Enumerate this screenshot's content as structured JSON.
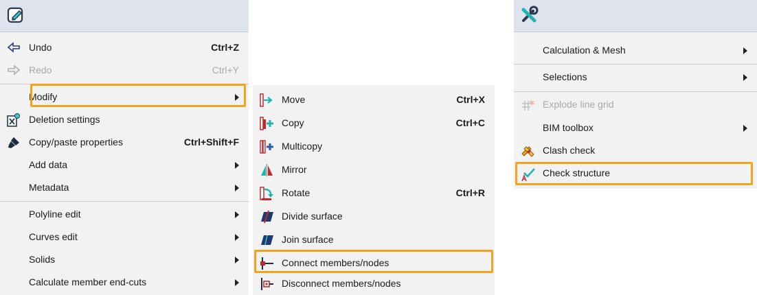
{
  "edit_menu": {
    "title_icon": "edit-pencil-icon",
    "items": [
      {
        "label": "Undo",
        "shortcut": "Ctrl+Z",
        "icon": "undo-arrow-icon"
      },
      {
        "label": "Redo",
        "shortcut": "Ctrl+Y",
        "icon": "redo-arrow-icon",
        "disabled": true
      },
      {
        "label": "Modify",
        "icon": "",
        "submenu": true
      },
      {
        "label": "Deletion settings",
        "icon": "deletion-settings-icon"
      },
      {
        "label": "Copy/paste properties",
        "shortcut": "Ctrl+Shift+F",
        "icon": "paint-brush-icon"
      },
      {
        "label": "Add data",
        "submenu": true
      },
      {
        "label": "Metadata",
        "submenu": true
      },
      {
        "label": "Polyline edit",
        "submenu": true
      },
      {
        "label": "Curves edit",
        "submenu": true
      },
      {
        "label": "Solids",
        "submenu": true
      },
      {
        "label": "Calculate member end-cuts",
        "submenu": true
      }
    ]
  },
  "modify_submenu": {
    "items": [
      {
        "label": "Move",
        "shortcut": "Ctrl+X",
        "icon": "move-icon"
      },
      {
        "label": "Copy",
        "shortcut": "Ctrl+C",
        "icon": "copy-icon"
      },
      {
        "label": "Multicopy",
        "icon": "multicopy-icon"
      },
      {
        "label": "Mirror",
        "icon": "mirror-icon"
      },
      {
        "label": "Rotate",
        "shortcut": "Ctrl+R",
        "icon": "rotate-icon"
      },
      {
        "label": "Divide surface",
        "icon": "divide-surface-icon"
      },
      {
        "label": "Join surface",
        "icon": "join-surface-icon"
      },
      {
        "label": "Connect members/nodes",
        "icon": "connect-nodes-icon"
      },
      {
        "label": "Disconnect members/nodes",
        "icon": "disconnect-nodes-icon"
      }
    ]
  },
  "tools_menu": {
    "title_icon": "tools-wrench-icon",
    "items": [
      {
        "label": "Calculation & Mesh",
        "submenu": true
      },
      {
        "label": "Selections",
        "submenu": true
      },
      {
        "label": "Explode line grid",
        "icon": "explode-grid-icon",
        "disabled": true
      },
      {
        "label": "BIM toolbox",
        "submenu": true
      },
      {
        "label": "Clash check",
        "icon": "clash-check-icon"
      },
      {
        "label": "Check structure",
        "icon": "check-structure-icon"
      }
    ]
  },
  "colors": {
    "highlight": "#f2a51a",
    "title_bar": "#dfe3ee",
    "menu_bg": "#f2f2f2"
  }
}
